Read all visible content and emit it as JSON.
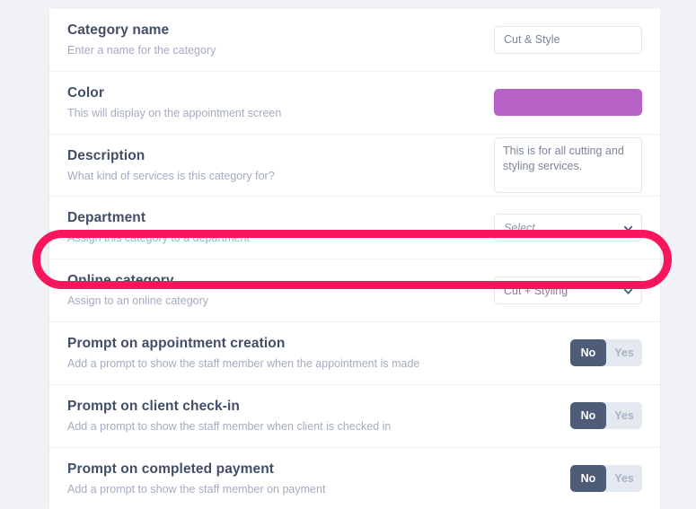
{
  "theme": {
    "page_background": "#f0f2f5",
    "card_background": "#ffffff",
    "title_color": "#414e68",
    "subtitle_color": "#a3acc0",
    "highlight_color": "#f7155b",
    "toggle_active_color": "#4e5c78",
    "toggle_inactive_color": "#e4e8ef"
  },
  "form": {
    "rows": [
      {
        "title": "Category name",
        "subtitle": "Enter a name for the category",
        "control": "text",
        "value": "Cut & Style",
        "placeholder": "Cut & Style"
      },
      {
        "title": "Color",
        "subtitle": "This will display on the appointment screen",
        "control": "color",
        "value": "#b561c6"
      },
      {
        "title": "Description",
        "subtitle": "What kind of services is this category for?",
        "control": "textarea",
        "value": "This is for all cutting and styling services.",
        "placeholder": "This is for all cutting and styling services."
      },
      {
        "title": "Department",
        "subtitle": "Assign this category to a department",
        "control": "select",
        "value": "Select...",
        "is_placeholder": true
      },
      {
        "title": "Online category",
        "subtitle": "Assign to an online category",
        "control": "select",
        "value": "Cut + Styling",
        "is_placeholder": false,
        "highlighted": true
      },
      {
        "title": "Prompt on appointment creation",
        "subtitle": "Add a prompt to show the staff member when the appointment is made",
        "control": "toggle",
        "options": [
          "No",
          "Yes"
        ],
        "selected": "No"
      },
      {
        "title": "Prompt on client check-in",
        "subtitle": "Add a prompt to show the staff member when client is checked in",
        "control": "toggle",
        "options": [
          "No",
          "Yes"
        ],
        "selected": "No"
      },
      {
        "title": "Prompt on completed payment",
        "subtitle": "Add a prompt to show the staff member on payment",
        "control": "toggle",
        "options": [
          "No",
          "Yes"
        ],
        "selected": "No"
      }
    ]
  },
  "icons": {
    "chevron_down": "chevron-down-icon"
  }
}
